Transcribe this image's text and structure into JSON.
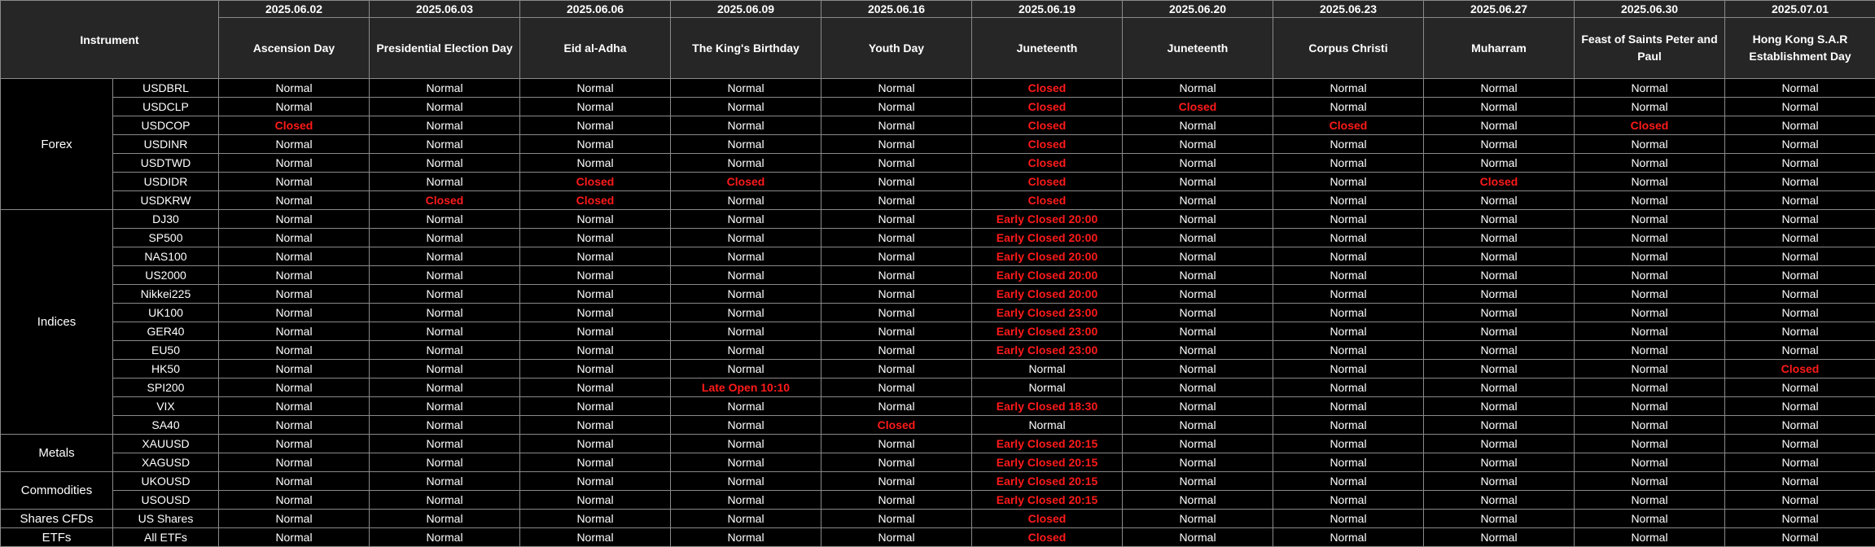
{
  "header": {
    "instrument": "Instrument",
    "dates": [
      "2025.06.02",
      "2025.06.03",
      "2025.06.06",
      "2025.06.09",
      "2025.06.16",
      "2025.06.19",
      "2025.06.20",
      "2025.06.23",
      "2025.06.27",
      "2025.06.30",
      "2025.07.01"
    ],
    "holidays": [
      "Ascension Day",
      "Presidential Election Day",
      "Eid al-Adha",
      "The King's Birthday",
      "Youth Day",
      "Juneteenth",
      "Juneteenth",
      "Corpus Christi",
      "Muharram",
      "Feast of Saints Peter and Paul",
      "Hong Kong S.A.R Establishment Day"
    ]
  },
  "colors": {
    "closed": "#ff1a1a",
    "normal": "#ffffff",
    "header_bg": "#262626",
    "body_bg": "#000000"
  },
  "groups": [
    {
      "name": "Forex",
      "rows": [
        {
          "instrument": "USDBRL",
          "values": [
            "Normal",
            "Normal",
            "Normal",
            "Normal",
            "Normal",
            "Closed",
            "Normal",
            "Normal",
            "Normal",
            "Normal",
            "Normal"
          ]
        },
        {
          "instrument": "USDCLP",
          "values": [
            "Normal",
            "Normal",
            "Normal",
            "Normal",
            "Normal",
            "Closed",
            "Closed",
            "Normal",
            "Normal",
            "Normal",
            "Normal"
          ]
        },
        {
          "instrument": "USDCOP",
          "values": [
            "Closed",
            "Normal",
            "Normal",
            "Normal",
            "Normal",
            "Closed",
            "Normal",
            "Closed",
            "Normal",
            "Closed",
            "Normal"
          ]
        },
        {
          "instrument": "USDINR",
          "values": [
            "Normal",
            "Normal",
            "Normal",
            "Normal",
            "Normal",
            "Closed",
            "Normal",
            "Normal",
            "Normal",
            "Normal",
            "Normal"
          ]
        },
        {
          "instrument": "USDTWD",
          "values": [
            "Normal",
            "Normal",
            "Normal",
            "Normal",
            "Normal",
            "Closed",
            "Normal",
            "Normal",
            "Normal",
            "Normal",
            "Normal"
          ]
        },
        {
          "instrument": "USDIDR",
          "values": [
            "Normal",
            "Normal",
            "Closed",
            "Closed",
            "Normal",
            "Closed",
            "Normal",
            "Normal",
            "Closed",
            "Normal",
            "Normal"
          ]
        },
        {
          "instrument": "USDKRW",
          "values": [
            "Normal",
            "Closed",
            "Closed",
            "Normal",
            "Normal",
            "Closed",
            "Normal",
            "Normal",
            "Normal",
            "Normal",
            "Normal"
          ]
        }
      ]
    },
    {
      "name": "Indices",
      "rows": [
        {
          "instrument": "DJ30",
          "values": [
            "Normal",
            "Normal",
            "Normal",
            "Normal",
            "Normal",
            "Early Closed 20:00",
            "Normal",
            "Normal",
            "Normal",
            "Normal",
            "Normal"
          ]
        },
        {
          "instrument": "SP500",
          "values": [
            "Normal",
            "Normal",
            "Normal",
            "Normal",
            "Normal",
            "Early Closed 20:00",
            "Normal",
            "Normal",
            "Normal",
            "Normal",
            "Normal"
          ]
        },
        {
          "instrument": "NAS100",
          "values": [
            "Normal",
            "Normal",
            "Normal",
            "Normal",
            "Normal",
            "Early Closed 20:00",
            "Normal",
            "Normal",
            "Normal",
            "Normal",
            "Normal"
          ]
        },
        {
          "instrument": "US2000",
          "values": [
            "Normal",
            "Normal",
            "Normal",
            "Normal",
            "Normal",
            "Early Closed 20:00",
            "Normal",
            "Normal",
            "Normal",
            "Normal",
            "Normal"
          ]
        },
        {
          "instrument": "Nikkei225",
          "values": [
            "Normal",
            "Normal",
            "Normal",
            "Normal",
            "Normal",
            "Early Closed 20:00",
            "Normal",
            "Normal",
            "Normal",
            "Normal",
            "Normal"
          ]
        },
        {
          "instrument": "UK100",
          "values": [
            "Normal",
            "Normal",
            "Normal",
            "Normal",
            "Normal",
            "Early Closed 23:00",
            "Normal",
            "Normal",
            "Normal",
            "Normal",
            "Normal"
          ]
        },
        {
          "instrument": "GER40",
          "values": [
            "Normal",
            "Normal",
            "Normal",
            "Normal",
            "Normal",
            "Early Closed 23:00",
            "Normal",
            "Normal",
            "Normal",
            "Normal",
            "Normal"
          ]
        },
        {
          "instrument": "EU50",
          "values": [
            "Normal",
            "Normal",
            "Normal",
            "Normal",
            "Normal",
            "Early Closed 23:00",
            "Normal",
            "Normal",
            "Normal",
            "Normal",
            "Normal"
          ]
        },
        {
          "instrument": "HK50",
          "values": [
            "Normal",
            "Normal",
            "Normal",
            "Normal",
            "Normal",
            "Normal",
            "Normal",
            "Normal",
            "Normal",
            "Normal",
            "Closed"
          ]
        },
        {
          "instrument": "SPI200",
          "values": [
            "Normal",
            "Normal",
            "Normal",
            "Late Open 10:10",
            "Normal",
            "Normal",
            "Normal",
            "Normal",
            "Normal",
            "Normal",
            "Normal"
          ]
        },
        {
          "instrument": "VIX",
          "values": [
            "Normal",
            "Normal",
            "Normal",
            "Normal",
            "Normal",
            "Early Closed 18:30",
            "Normal",
            "Normal",
            "Normal",
            "Normal",
            "Normal"
          ]
        },
        {
          "instrument": "SA40",
          "values": [
            "Normal",
            "Normal",
            "Normal",
            "Normal",
            "Closed",
            "Normal",
            "Normal",
            "Normal",
            "Normal",
            "Normal",
            "Normal"
          ]
        }
      ]
    },
    {
      "name": "Metals",
      "rows": [
        {
          "instrument": "XAUUSD",
          "values": [
            "Normal",
            "Normal",
            "Normal",
            "Normal",
            "Normal",
            "Early Closed 20:15",
            "Normal",
            "Normal",
            "Normal",
            "Normal",
            "Normal"
          ]
        },
        {
          "instrument": "XAGUSD",
          "values": [
            "Normal",
            "Normal",
            "Normal",
            "Normal",
            "Normal",
            "Early Closed 20:15",
            "Normal",
            "Normal",
            "Normal",
            "Normal",
            "Normal"
          ]
        }
      ]
    },
    {
      "name": "Commodities",
      "rows": [
        {
          "instrument": "UKOUSD",
          "values": [
            "Normal",
            "Normal",
            "Normal",
            "Normal",
            "Normal",
            "Early Closed 20:15",
            "Normal",
            "Normal",
            "Normal",
            "Normal",
            "Normal"
          ]
        },
        {
          "instrument": "USOUSD",
          "values": [
            "Normal",
            "Normal",
            "Normal",
            "Normal",
            "Normal",
            "Early Closed 20:15",
            "Normal",
            "Normal",
            "Normal",
            "Normal",
            "Normal"
          ]
        }
      ]
    },
    {
      "name": "Shares CFDs",
      "rows": [
        {
          "instrument": "US Shares",
          "values": [
            "Normal",
            "Normal",
            "Normal",
            "Normal",
            "Normal",
            "Closed",
            "Normal",
            "Normal",
            "Normal",
            "Normal",
            "Normal"
          ]
        }
      ]
    },
    {
      "name": "ETFs",
      "rows": [
        {
          "instrument": "All ETFs",
          "values": [
            "Normal",
            "Normal",
            "Normal",
            "Normal",
            "Normal",
            "Closed",
            "Normal",
            "Normal",
            "Normal",
            "Normal",
            "Normal"
          ]
        }
      ]
    }
  ]
}
